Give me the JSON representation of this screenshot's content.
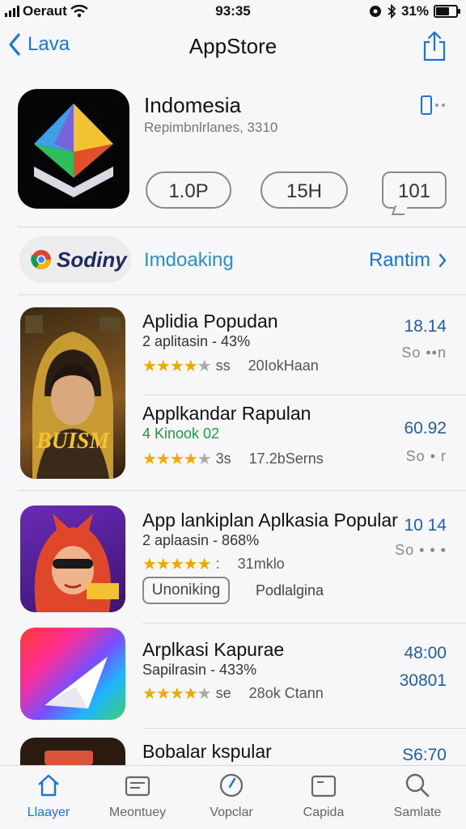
{
  "status_bar": {
    "carrier": "Oeraut",
    "time": "93:35",
    "battery": "31%"
  },
  "nav": {
    "back_label": "Lava",
    "title": "AppStore"
  },
  "hero": {
    "name": "Indomesia",
    "subtitle": "Repimbnlrlanes, 3310",
    "rating_pill": "1.0P",
    "size_pill": "15H",
    "message_pill": "101"
  },
  "category_bar": {
    "tag_label": "Sodiny",
    "category": "Imdoaking",
    "see_all": "Rantim"
  },
  "apps": [
    {
      "title": "Aplidia Popudan",
      "subtitle": "2 aplitasin - 43%",
      "stars": 3.5,
      "star_suffix": "ss",
      "reviews": "20IokHaan",
      "right_top": "18.14",
      "right_bottom": "So ••n",
      "icon_text": "BUISM"
    },
    {
      "title": "Applkandar Rapulan",
      "subtitle": "4 Kinook 02",
      "stars": 3.5,
      "star_suffix": "3s",
      "reviews": "17.2bSerns",
      "right_top": "60.92",
      "right_bottom": "So • r"
    },
    {
      "title": "App lankiplan Aplkasia Popular",
      "subtitle": "2 aplaasin - 868%",
      "stars": 4.5,
      "star_suffix": ":",
      "reviews": "31mklo",
      "right_top": "10 14",
      "right_bottom": "So • • •",
      "button": "Unoniking",
      "button_side": "Podlalgina"
    },
    {
      "title": "Arplkasi Kapurae",
      "subtitle": "Sapilrasin - 433%",
      "stars": 4,
      "star_suffix": "se",
      "reviews": "28ok Ctann",
      "right_top": "48:00",
      "right_bottom": "30801"
    },
    {
      "title": "Bobalar kspular",
      "right_top": "S6:70"
    }
  ],
  "tabbar": {
    "tabs": [
      {
        "label": "Llaayer",
        "icon": "home-icon"
      },
      {
        "label": "Meontuey",
        "icon": "apps-icon"
      },
      {
        "label": "Vopclar",
        "icon": "compass-icon"
      },
      {
        "label": "Capida",
        "icon": "window-icon"
      },
      {
        "label": "Samlate",
        "icon": "search-icon"
      }
    ]
  },
  "colors": {
    "accent": "#1a73d9",
    "star": "#f0a700",
    "category": "#2b8fc8"
  }
}
